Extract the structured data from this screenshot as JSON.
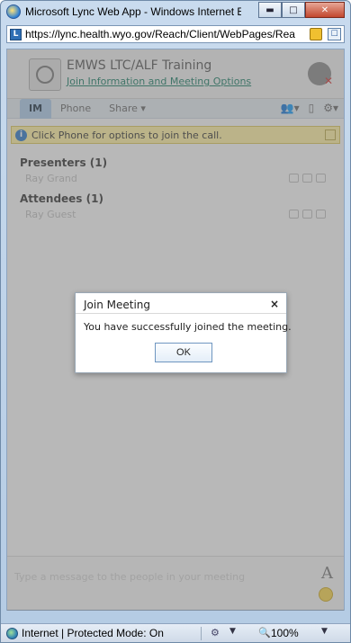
{
  "window": {
    "title": "Microsoft Lync Web App - Windows Internet E...",
    "minimize_glyph": "▬",
    "maximize_glyph": "□",
    "close_glyph": "✕",
    "icon": "ie-logo-icon"
  },
  "address": {
    "url": "https://lync.health.wyo.gov/Reach/Client/WebPages/Rea",
    "compat_glyph": "☐"
  },
  "app": {
    "meeting_title": "EMWS LTC/ALF Training",
    "join_link": "Join Information and Meeting Options",
    "tabs": [
      "IM",
      "Phone",
      "Share ▾"
    ],
    "tab_icons": [
      "people-icon",
      "attachment-icon",
      "settings-icon"
    ],
    "info_bar": {
      "glyph": "i",
      "text": "Click Phone for options to join the call."
    },
    "roster": {
      "presenters_label": "Presenters (1)",
      "presenter_name": "Ray Grand",
      "attendees_label": "Attendees (1)",
      "attendee_name": "Ray Guest"
    },
    "chat_placeholder": "Type a message to the people in your meeting",
    "font_glyph": "A"
  },
  "dialog": {
    "title": "Join Meeting",
    "close_glyph": "×",
    "message": "You have successfully joined the meeting.",
    "ok_label": "OK"
  },
  "statusbar": {
    "zone": "Internet | Protected Mode: On",
    "zoom_ctrl_glyph": "⚙",
    "zoom_ctrl_caret": "▼",
    "zoom_glyph": "🔍",
    "zoom": "100%",
    "zoom_caret": "▼"
  },
  "colors": {
    "accent": "#1a7a63",
    "info_bar": "#f9ec9e",
    "tab_active": "#a9c6e3"
  }
}
